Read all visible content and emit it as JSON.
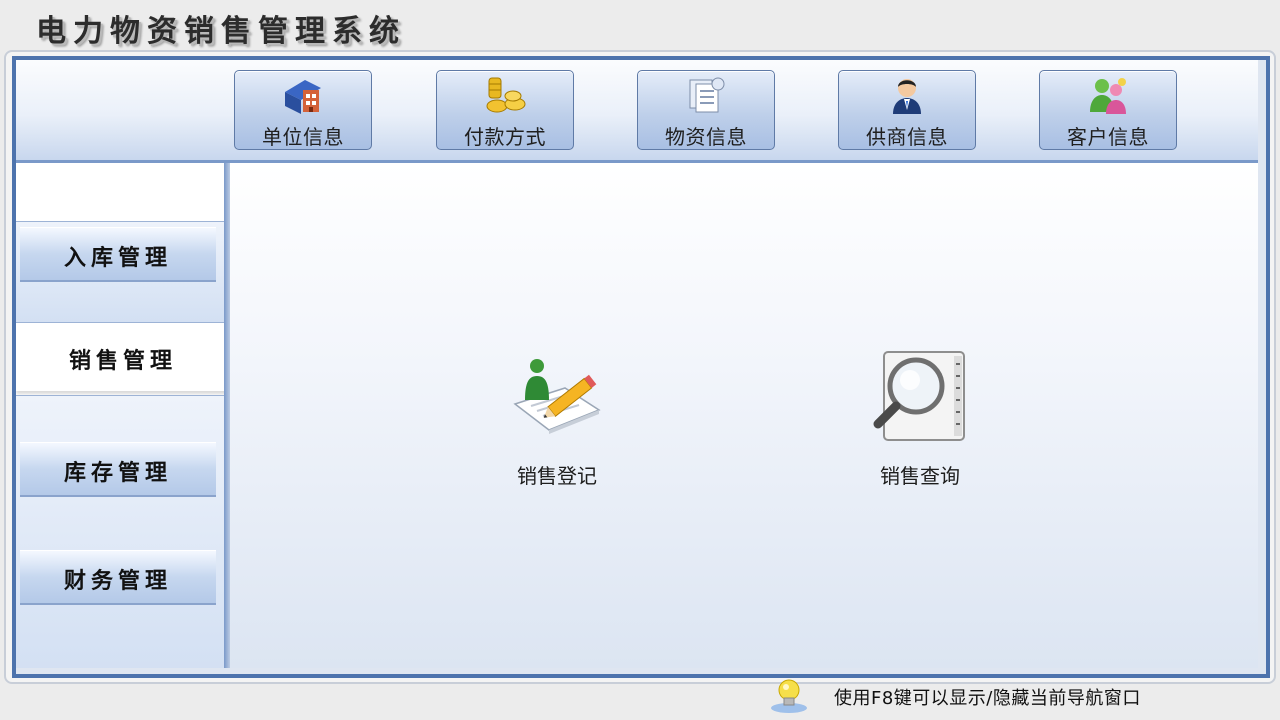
{
  "app": {
    "title": "电力物资销售管理系统"
  },
  "toolbar": {
    "items": [
      {
        "label": "单位信息",
        "icon": "building-icon"
      },
      {
        "label": "付款方式",
        "icon": "coins-icon"
      },
      {
        "label": "物资信息",
        "icon": "documents-icon"
      },
      {
        "label": "供商信息",
        "icon": "person-icon"
      },
      {
        "label": "客户信息",
        "icon": "users-icon"
      }
    ]
  },
  "sidebar": {
    "items": [
      {
        "label": "入库管理",
        "active": false
      },
      {
        "label": "销售管理",
        "active": true
      },
      {
        "label": "库存管理",
        "active": false
      },
      {
        "label": "财务管理",
        "active": false
      }
    ]
  },
  "content": {
    "items": [
      {
        "label": "销售登记",
        "icon": "register-pencil-icon"
      },
      {
        "label": "销售查询",
        "icon": "search-magnifier-icon"
      }
    ]
  },
  "status": {
    "hint": "使用F8键可以显示/隐藏当前导航窗口",
    "icon": "lightbulb-icon"
  },
  "colors": {
    "frame_blue": "#4d73ad",
    "toolbar_button": "#bfd0ea",
    "background": "#ececec"
  }
}
